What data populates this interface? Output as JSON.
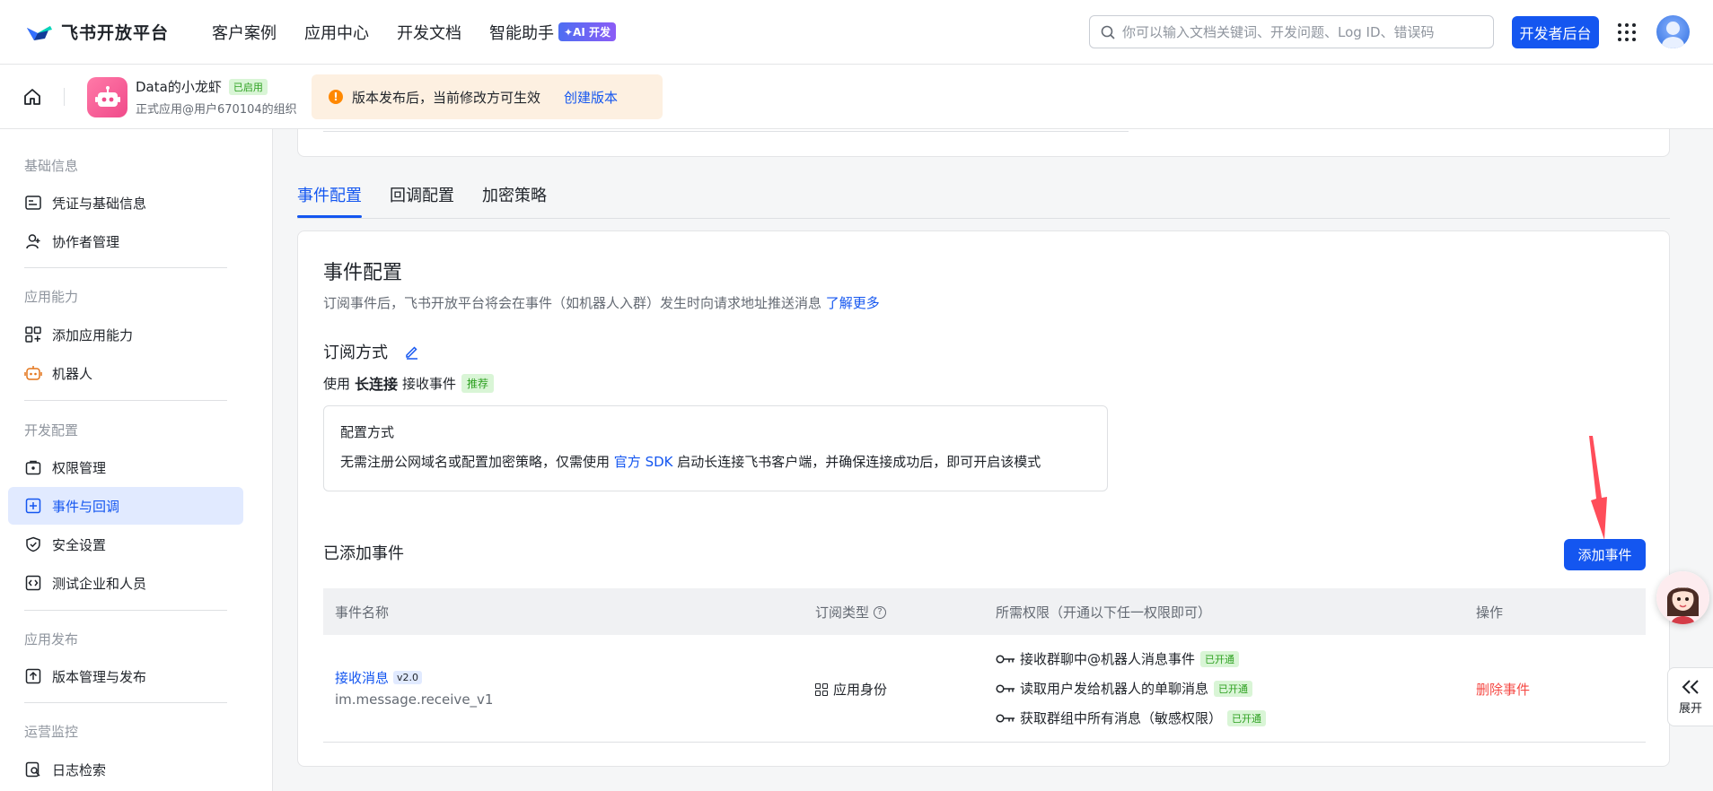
{
  "topnav": {
    "logo_text": "飞书开放平台",
    "links": [
      "客户案例",
      "应用中心",
      "开发文档",
      "智能助手"
    ],
    "ai_badge": "✦AI 开发",
    "search_placeholder": "你可以输入文档关键词、开发问题、Log ID、错误码",
    "dev_button": "开发者后台"
  },
  "appbar": {
    "app_name": "Data的小龙虾",
    "status": "已启用",
    "subtitle": "正式应用@用户670104的组织",
    "notice_text": "版本发布后，当前修改方可生效",
    "notice_link": "创建版本"
  },
  "sidebar": {
    "groups": [
      {
        "title": "基础信息",
        "items": [
          {
            "label": "凭证与基础信息",
            "icon": "credential-icon"
          },
          {
            "label": "协作者管理",
            "icon": "collaborator-icon"
          }
        ]
      },
      {
        "title": "应用能力",
        "items": [
          {
            "label": "添加应用能力",
            "icon": "add-ability-icon"
          },
          {
            "label": "机器人",
            "icon": "robot-icon"
          }
        ]
      },
      {
        "title": "开发配置",
        "items": [
          {
            "label": "权限管理",
            "icon": "permission-icon"
          },
          {
            "label": "事件与回调",
            "icon": "event-icon",
            "active": true
          },
          {
            "label": "安全设置",
            "icon": "shield-icon"
          },
          {
            "label": "测试企业和人员",
            "icon": "test-icon"
          }
        ]
      },
      {
        "title": "应用发布",
        "items": [
          {
            "label": "版本管理与发布",
            "icon": "publish-icon"
          }
        ]
      },
      {
        "title": "运营监控",
        "items": [
          {
            "label": "日志检索",
            "icon": "log-icon"
          }
        ]
      }
    ]
  },
  "tabs": [
    "事件配置",
    "回调配置",
    "加密策略"
  ],
  "card": {
    "title": "事件配置",
    "desc": "订阅事件后，飞书开放平台将会在事件（如机器人入群）发生时向请求地址推送消息",
    "desc_link": "了解更多",
    "sub_title": "订阅方式",
    "use_prefix": "使用",
    "use_bold": "长连接",
    "use_suffix": "接收事件",
    "rec_tag": "推荐",
    "config_title": "配置方式",
    "config_text_1": "无需注册公网域名或配置加密策略，仅需使用",
    "config_link": "官方 SDK",
    "config_text_2": "启动长连接飞书客户端，并确保连接成功后，即可开启该模式",
    "added_title": "已添加事件",
    "add_button": "添加事件"
  },
  "table": {
    "headers": [
      "事件名称",
      "订阅类型",
      "所需权限（开通以下任一权限即可）",
      "操作"
    ],
    "rows": [
      {
        "event_name": "接收消息",
        "version": "v2.0",
        "event_code": "im.message.receive_v1",
        "sub_type": "应用身份",
        "permissions": [
          {
            "label": "接收群聊中@机器人消息事件",
            "status": "已开通"
          },
          {
            "label": "读取用户发给机器人的单聊消息",
            "status": "已开通"
          },
          {
            "label": "获取群组中所有消息（敏感权限）",
            "status": "已开通"
          }
        ],
        "action": "删除事件"
      }
    ]
  },
  "floating": {
    "expand_label": "展开"
  },
  "colors": {
    "primary": "#1456f0",
    "danger": "#f54a45",
    "success": "#2ea121",
    "annotation_arrow": "#ff4d5a"
  }
}
